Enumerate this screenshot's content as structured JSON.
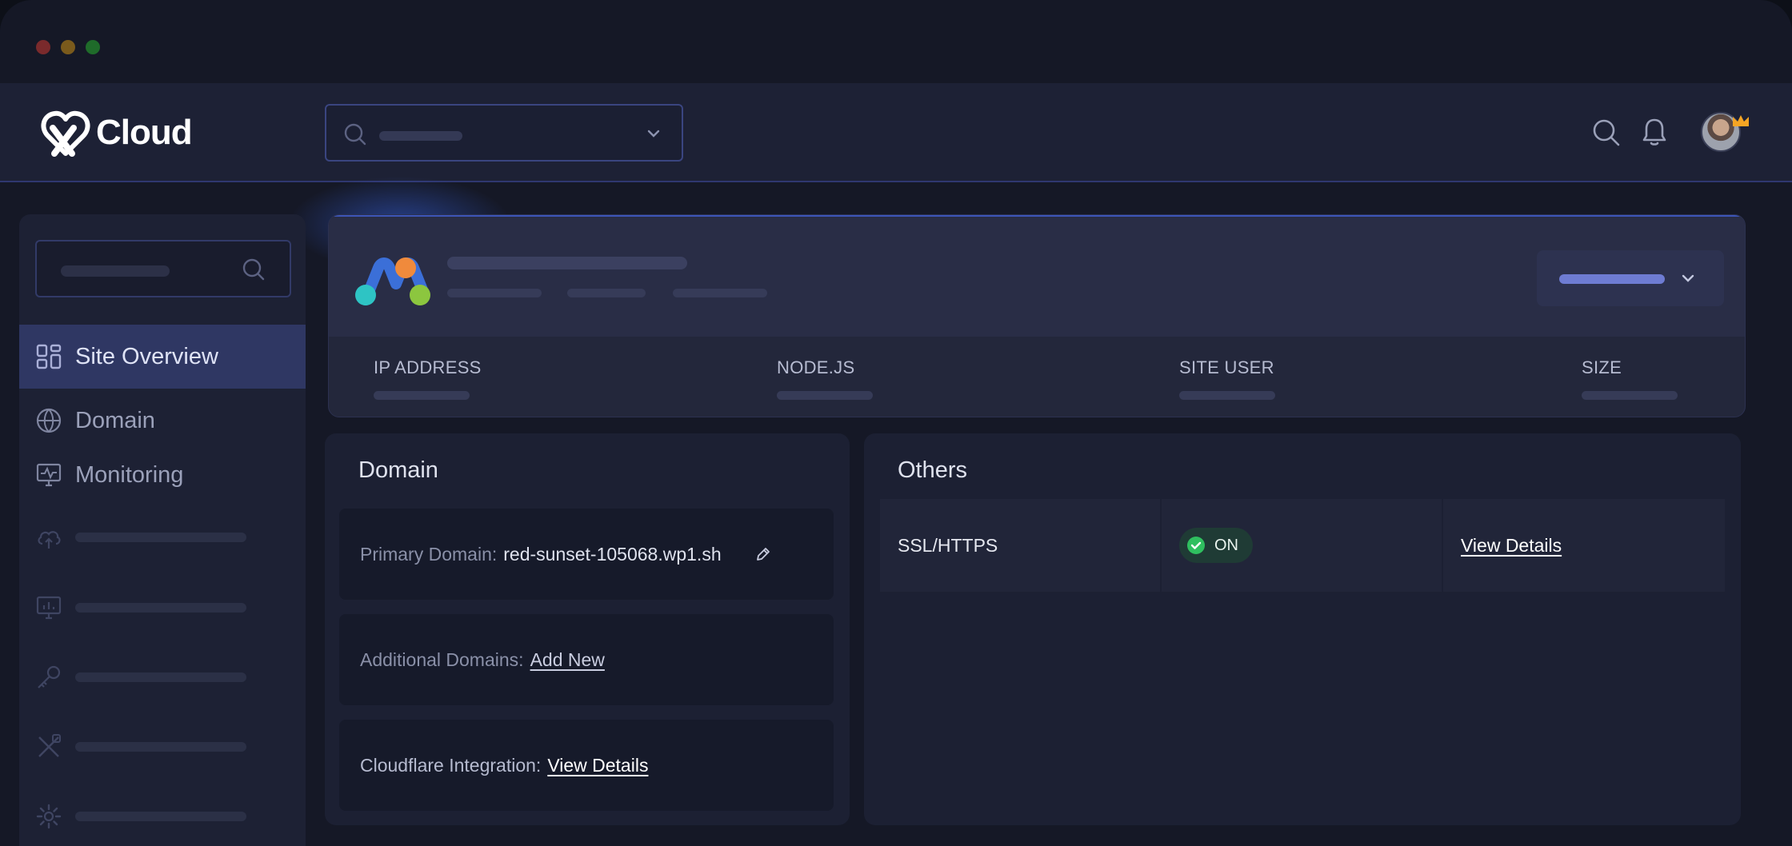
{
  "window": {
    "controls": [
      "close",
      "minimize",
      "maximize"
    ],
    "control_colors": [
      "#ff5f57",
      "#febc2e",
      "#28c840"
    ]
  },
  "header": {
    "logo_text": "Cloud",
    "search_icon": "search-icon",
    "notification_icon": "bell-icon",
    "badge_icon": "crown-icon"
  },
  "sidebar": {
    "items": [
      {
        "label": "Site Overview",
        "icon": "grid-icon",
        "active": true
      },
      {
        "label": "Domain",
        "icon": "www-globe-icon"
      },
      {
        "label": "Monitoring",
        "icon": "monitor-pulse-icon"
      }
    ],
    "placeholder_icons": [
      "cloud-upload-icon",
      "monitor-chart-icon",
      "key-icon",
      "tools-icon",
      "gear-icon"
    ]
  },
  "site": {
    "info_labels": {
      "ip": "IP ADDRESS",
      "node": "NODE.JS",
      "user": "SITE USER",
      "size": "SIZE"
    }
  },
  "domain_card": {
    "title": "Domain",
    "primary_label": "Primary Domain:",
    "primary_value": "red-sunset-105068.wp1.sh",
    "additional_label": "Additional Domains:",
    "additional_link": "Add New",
    "cloudflare_label": "Cloudflare Integration:",
    "cloudflare_link": "View Details"
  },
  "others_card": {
    "title": "Others",
    "ssl_label": "SSL/HTTPS",
    "ssl_status": "ON",
    "ssl_link": "View Details",
    "status_color": "#2fbf5f"
  }
}
